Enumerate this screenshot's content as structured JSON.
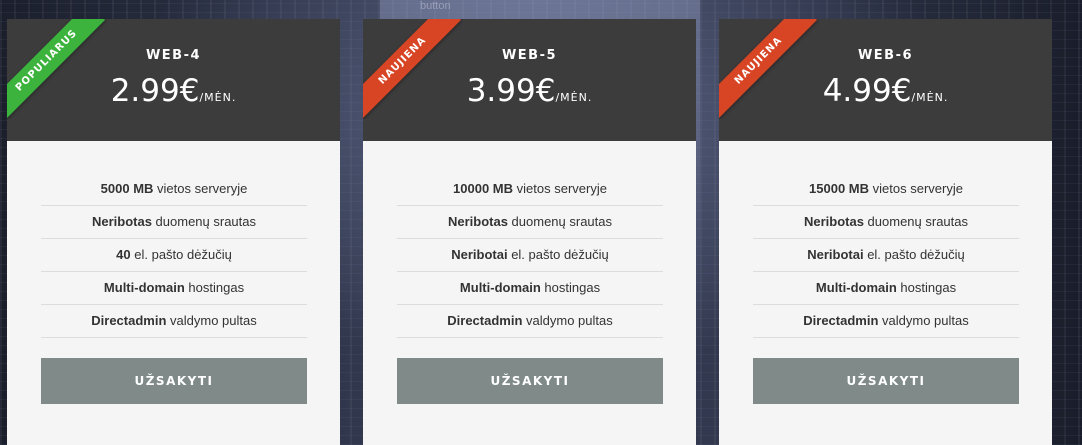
{
  "background": {
    "hint_text": "button"
  },
  "colors": {
    "header_bg": "#3c3c3c",
    "card_bg": "#f5f5f5",
    "button_bg": "#7f8a89",
    "ribbon_popular": "#3cb33c",
    "ribbon_new": "#d84525"
  },
  "plans": [
    {
      "name": "WEB-4",
      "price": "2.99€",
      "period": "/MĖN.",
      "ribbon": {
        "label": "POPULIARUS",
        "color": "#3cb33c"
      },
      "features": [
        {
          "bold": "5000 MB",
          "rest": " vietos serveryje"
        },
        {
          "bold": "Neribotas",
          "rest": " duomenų srautas"
        },
        {
          "bold": "40",
          "rest": " el. pašto dėžučių"
        },
        {
          "bold": "Multi-domain",
          "rest": " hostingas"
        },
        {
          "bold": "Directadmin",
          "rest": " valdymo pultas"
        }
      ],
      "button_label": "UŽSAKYTI"
    },
    {
      "name": "WEB-5",
      "price": "3.99€",
      "period": "/MĖN.",
      "ribbon": {
        "label": "NAUJIENA",
        "color": "#d84525"
      },
      "features": [
        {
          "bold": "10000 MB",
          "rest": " vietos serveryje"
        },
        {
          "bold": "Neribotas",
          "rest": " duomenų srautas"
        },
        {
          "bold": "Neribotai",
          "rest": " el. pašto dėžučių"
        },
        {
          "bold": "Multi-domain",
          "rest": " hostingas"
        },
        {
          "bold": "Directadmin",
          "rest": " valdymo pultas"
        }
      ],
      "button_label": "UŽSAKYTI"
    },
    {
      "name": "WEB-6",
      "price": "4.99€",
      "period": "/MĖN.",
      "ribbon": {
        "label": "NAUJIENA",
        "color": "#d84525"
      },
      "features": [
        {
          "bold": "15000 MB",
          "rest": " vietos serveryje"
        },
        {
          "bold": "Neribotas",
          "rest": " duomenų srautas"
        },
        {
          "bold": "Neribotai",
          "rest": " el. pašto dėžučių"
        },
        {
          "bold": "Multi-domain",
          "rest": " hostingas"
        },
        {
          "bold": "Directadmin",
          "rest": " valdymo pultas"
        }
      ],
      "button_label": "UŽSAKYTI"
    }
  ]
}
